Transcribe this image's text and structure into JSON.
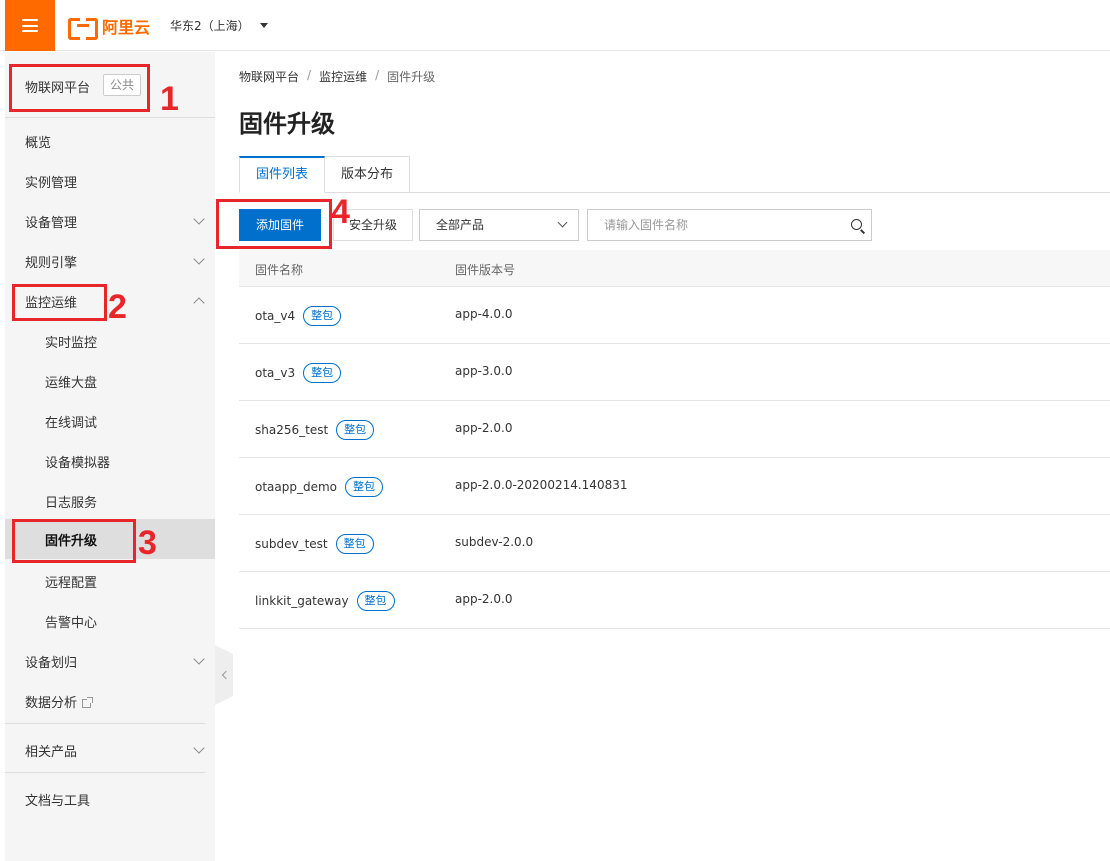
{
  "topbar": {
    "logo_text": "阿里云",
    "region": "华东2（上海）"
  },
  "sidebar": {
    "platform_title": "物联网平台",
    "platform_badge": "公共",
    "items": [
      {
        "label": "概览"
      },
      {
        "label": "实例管理"
      },
      {
        "label": "设备管理"
      },
      {
        "label": "规则引擎"
      },
      {
        "label": "监控运维"
      },
      {
        "label": "实时监控"
      },
      {
        "label": "运维大盘"
      },
      {
        "label": "在线调试"
      },
      {
        "label": "设备模拟器"
      },
      {
        "label": "日志服务"
      },
      {
        "label": "固件升级"
      },
      {
        "label": "远程配置"
      },
      {
        "label": "告警中心"
      },
      {
        "label": "设备划归"
      },
      {
        "label": "数据分析"
      },
      {
        "label": "相关产品"
      },
      {
        "label": "文档与工具"
      }
    ]
  },
  "annotations": [
    "1",
    "2",
    "3",
    "4"
  ],
  "breadcrumb": [
    "物联网平台",
    "监控运维",
    "固件升级"
  ],
  "page_title": "固件升级",
  "tabs": [
    "固件列表",
    "版本分布"
  ],
  "toolbar": {
    "add_label": "添加固件",
    "secure_label": "安全升级",
    "product_select": "全部产品",
    "search_placeholder": "请输入固件名称"
  },
  "table": {
    "headers": [
      "固件名称",
      "固件版本号"
    ],
    "badge": "整包",
    "rows": [
      {
        "name": "ota_v4",
        "version": "app-4.0.0"
      },
      {
        "name": "ota_v3",
        "version": "app-3.0.0"
      },
      {
        "name": "sha256_test",
        "version": "app-2.0.0"
      },
      {
        "name": "otaapp_demo",
        "version": "app-2.0.0-20200214.140831"
      },
      {
        "name": "subdev_test",
        "version": "subdev-2.0.0"
      },
      {
        "name": "linkkit_gateway",
        "version": "app-2.0.0"
      }
    ]
  },
  "colors": {
    "brand": "#ff6a00",
    "primary": "#0070cc",
    "annotation": "#e8262a"
  }
}
